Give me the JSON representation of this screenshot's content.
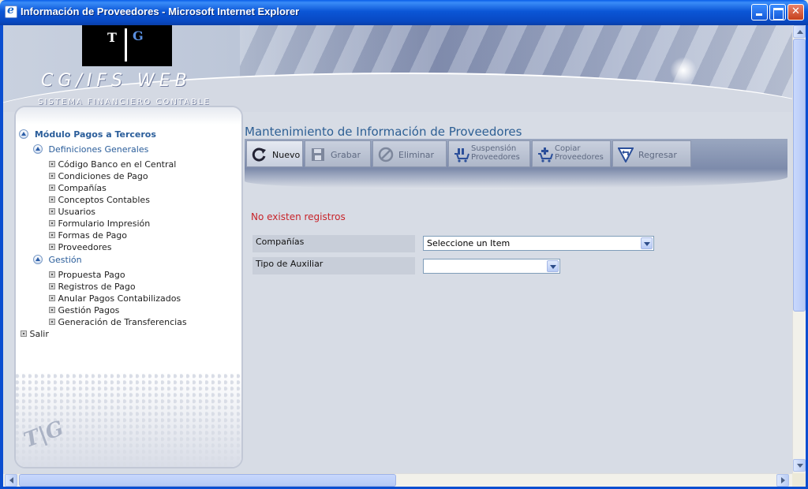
{
  "window": {
    "title": "Información de Proveedores - Microsoft Internet Explorer"
  },
  "banner": {
    "logo_t": "T",
    "logo_g": "G",
    "brand": "CG/IFS WEB",
    "subtitle": "SISTEMA FINANCIERO CONTABLE"
  },
  "sidebar": {
    "module": "Módulo Pagos a Terceros",
    "groups": [
      {
        "label": "Definiciones Generales",
        "items": [
          "Código Banco en el Central",
          "Condiciones de Pago",
          "Compañías",
          "Conceptos Contables",
          "Usuarios",
          "Formulario Impresión",
          "Formas de Pago",
          "Proveedores"
        ]
      },
      {
        "label": "Gestión",
        "items": [
          "Propuesta Pago",
          "Registros de Pago",
          "Anular Pagos Contabilizados",
          "Gestión Pagos",
          "Generación de Transferencias"
        ]
      }
    ],
    "exit": "Salir"
  },
  "main": {
    "title": "Mantenimiento de Información de Proveedores",
    "toolbar": {
      "nuevo": "Nuevo",
      "grabar": "Grabar",
      "eliminar": "Eliminar",
      "suspension_1": "Suspensión",
      "suspension_2": "Proveedores",
      "copiar_1": "Copiar",
      "copiar_2": "Proveedores",
      "regresar": "Regresar"
    },
    "message": "No existen registros",
    "form": {
      "companias_label": "Compañías",
      "companias_value": "Seleccione un Item",
      "tipo_label": "Tipo de Auxiliar",
      "tipo_value": ""
    }
  },
  "colors": {
    "accent": "#2d5f94",
    "error": "#c8242a",
    "titlebar": "#0b56d6"
  }
}
